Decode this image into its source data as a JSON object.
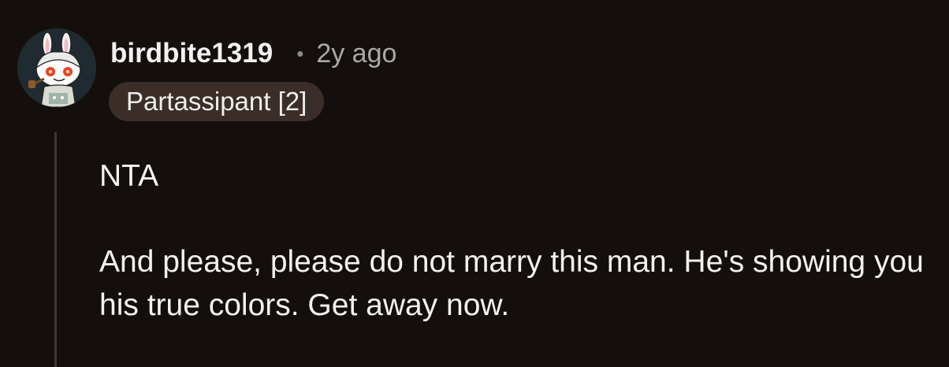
{
  "comment": {
    "author": "birdbite1319",
    "separator": "•",
    "time_ago": "2y ago",
    "flair": "Partassipant [2]",
    "paragraphs": [
      "NTA",
      "And please, please do not marry this man. He's showing you his true colors. Get away now."
    ]
  },
  "avatar": {
    "icon": "snoo-bunny-avatar-icon"
  },
  "colors": {
    "background": "#140f0d",
    "text": "#f2f2f2",
    "meta_text": "#a8a8a8",
    "flair_background": "#3b2e28",
    "thread_line": "#3d3734"
  }
}
